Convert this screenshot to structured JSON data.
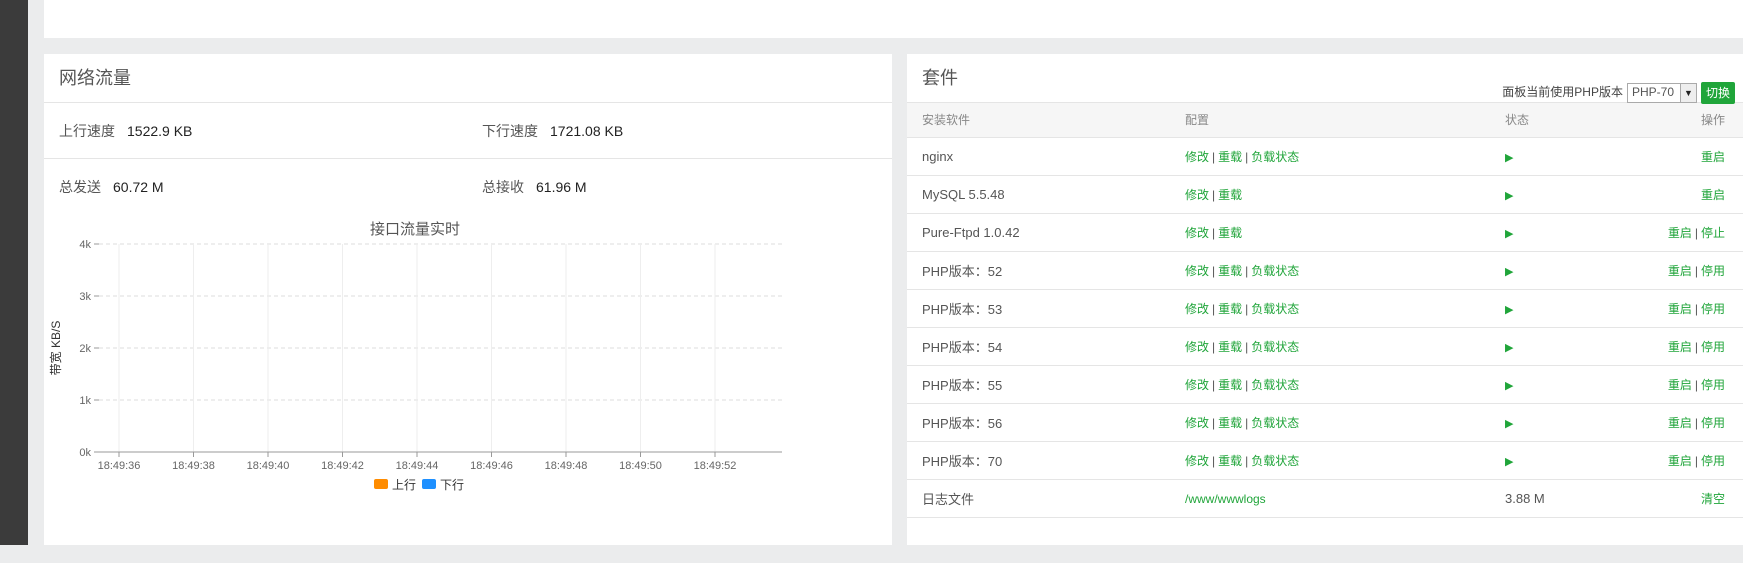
{
  "network": {
    "title": "网络流量",
    "upload_speed_label": "上行速度",
    "upload_speed_value": "1522.9 KB",
    "download_speed_label": "下行速度",
    "download_speed_value": "1721.08 KB",
    "total_sent_label": "总发送",
    "total_sent_value": "60.72 M",
    "total_received_label": "总接收",
    "total_received_value": "61.96 M"
  },
  "chart_data": {
    "type": "line",
    "title": "接口流量实时",
    "ylabel": "带宽 KB/S",
    "xlabel": "",
    "ylim": [
      0,
      4
    ],
    "y_ticks": [
      "0k",
      "1k",
      "2k",
      "3k",
      "4k"
    ],
    "categories": [
      "18:49:36",
      "18:49:38",
      "18:49:40",
      "18:49:42",
      "18:49:44",
      "18:49:46",
      "18:49:48",
      "18:49:50",
      "18:49:52"
    ],
    "series": [
      {
        "name": "上行",
        "values": [],
        "color": "#ff8c00"
      },
      {
        "name": "下行",
        "values": [],
        "color": "#1e90ff"
      }
    ],
    "legend": "bottom",
    "grid": true
  },
  "soft": {
    "title": "套件",
    "php_label": "面板当前使用PHP版本",
    "php_selected": "PHP-70",
    "switch_label": "切换",
    "headers": [
      "安装软件",
      "配置",
      "状态",
      "操作"
    ],
    "rows": [
      {
        "name": "nginx",
        "config": [
          "修改",
          "重载",
          "负载状态"
        ],
        "status": "▶",
        "ops": [
          "重启"
        ]
      },
      {
        "name": "MySQL 5.5.48",
        "config": [
          "修改",
          "重载"
        ],
        "status": "▶",
        "ops": [
          "重启"
        ]
      },
      {
        "name": "Pure-Ftpd 1.0.42",
        "config": [
          "修改",
          "重载"
        ],
        "status": "▶",
        "ops": [
          "重启",
          "停止"
        ]
      },
      {
        "name": "PHP版本：52",
        "config": [
          "修改",
          "重载",
          "负载状态"
        ],
        "status": "▶",
        "ops": [
          "重启",
          "停用"
        ]
      },
      {
        "name": "PHP版本：53",
        "config": [
          "修改",
          "重载",
          "负载状态"
        ],
        "status": "▶",
        "ops": [
          "重启",
          "停用"
        ]
      },
      {
        "name": "PHP版本：54",
        "config": [
          "修改",
          "重载",
          "负载状态"
        ],
        "status": "▶",
        "ops": [
          "重启",
          "停用"
        ]
      },
      {
        "name": "PHP版本：55",
        "config": [
          "修改",
          "重载",
          "负载状态"
        ],
        "status": "▶",
        "ops": [
          "重启",
          "停用"
        ]
      },
      {
        "name": "PHP版本：56",
        "config": [
          "修改",
          "重载",
          "负载状态"
        ],
        "status": "▶",
        "ops": [
          "重启",
          "停用"
        ]
      },
      {
        "name": "PHP版本：70",
        "config": [
          "修改",
          "重载",
          "负载状态"
        ],
        "status": "▶",
        "ops": [
          "重启",
          "停用"
        ]
      }
    ],
    "log": {
      "name": "日志文件",
      "path": "/www/wwwlogs",
      "size": "3.88 M",
      "op": "清空"
    }
  },
  "colors": {
    "accent": "#20a53a",
    "upload": "#ff8c00",
    "download": "#1e90ff"
  }
}
